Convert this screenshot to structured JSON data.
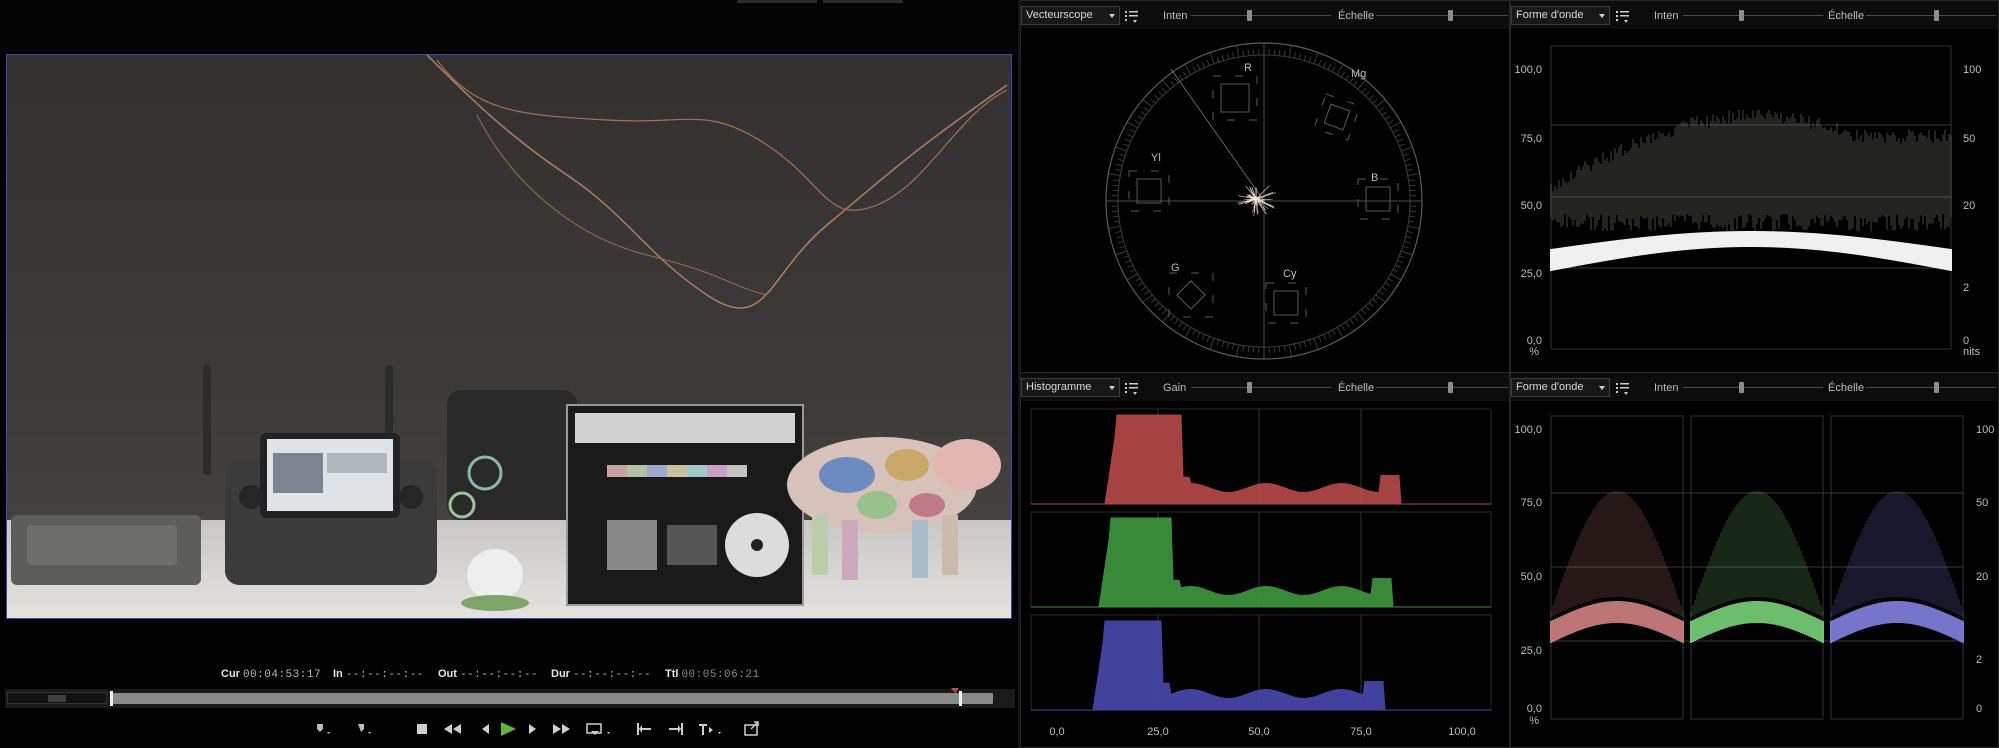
{
  "timecodes": {
    "cur_label": "Cur",
    "cur_value": "00:04:53:17",
    "in_label": "In",
    "in_value": "--:--:--:--",
    "out_label": "Out",
    "out_value": "--:--:--:--",
    "dur_label": "Dur",
    "dur_value": "--:--:--:--",
    "ttl_label": "Ttl",
    "ttl_value": "00:05:06:21"
  },
  "playback": {
    "position_fraction": 0.962
  },
  "transport": {
    "icons": [
      "mark-in-icon",
      "mark-out-icon",
      "stop-icon",
      "rewind-icon",
      "prev-frame-icon",
      "play-icon",
      "next-frame-icon",
      "fast-forward-icon",
      "playback-mode-icon",
      "go-to-in-icon",
      "go-to-out-icon",
      "insert-icon",
      "export-icon"
    ],
    "accent": "#5fb83a"
  },
  "scopes": {
    "top_left": {
      "type": "Vecteurscope",
      "slider1": "Inten",
      "slider2": "Échelle",
      "vector_labels": [
        "R",
        "Mg",
        "B",
        "Cy",
        "G",
        "Yl"
      ]
    },
    "top_right": {
      "type": "Forme d'onde",
      "slider1": "Inten",
      "slider2": "Échelle",
      "left_ticks": [
        "100,0",
        "75,0",
        "50,0",
        "25,0",
        "0,0"
      ],
      "left_unit": "%",
      "right_ticks": [
        "100",
        "50",
        "20",
        "2",
        "0"
      ],
      "right_unit": "nits"
    },
    "bottom_left": {
      "type": "Histogramme",
      "slider1": "Gain",
      "slider2": "Échelle",
      "x_ticks": [
        "0,0",
        "25,0",
        "50,0",
        "75,0",
        "100,0"
      ],
      "channel_colors": [
        "#b94a4a",
        "#3f9a3f",
        "#4a4ab0"
      ]
    },
    "bottom_right": {
      "type": "Forme d'onde",
      "slider1": "Inten",
      "slider2": "Échelle",
      "left_ticks": [
        "100,0",
        "75,0",
        "50,0",
        "25,0",
        "0,0"
      ],
      "left_unit": "%",
      "right_ticks": [
        "100",
        "50",
        "20",
        "2",
        "0"
      ],
      "channel_colors": [
        "#e08a8a",
        "#7fe07f",
        "#8a8af0"
      ]
    }
  }
}
